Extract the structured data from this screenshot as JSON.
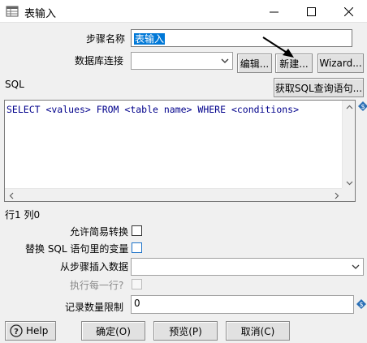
{
  "window": {
    "title": "表输入",
    "minimize": "—",
    "maximize": "☐",
    "close": "✕"
  },
  "step_name": {
    "label": "步骤名称",
    "value": "表输入"
  },
  "connection": {
    "label": "数据库连接",
    "value": "",
    "edit_button": "编辑...",
    "new_button": "新建...",
    "wizard_button": "Wizard..."
  },
  "sql": {
    "label": "SQL",
    "get_sql_button": "获取SQL查询语句...",
    "text": "SELECT <values> FROM <table name> WHERE <conditions>"
  },
  "cursor_position": "行1 列0",
  "options": {
    "lazy_conversion_label": "允许简易转换",
    "replace_variables_label": "替换 SQL 语句里的变量",
    "insert_from_step_label": "从步骤插入数据",
    "insert_from_step_value": "",
    "execute_each_row_label": "执行每一行?",
    "limit_label": "记录数量限制",
    "limit_value": "0"
  },
  "buttons": {
    "help": "Help",
    "ok": "确定(O)",
    "preview": "预览(P)",
    "cancel": "取消(C)"
  },
  "colors": {
    "sql_text": "#00008b",
    "selection": "#0078d7",
    "var_icon": "#2a6fb5"
  }
}
